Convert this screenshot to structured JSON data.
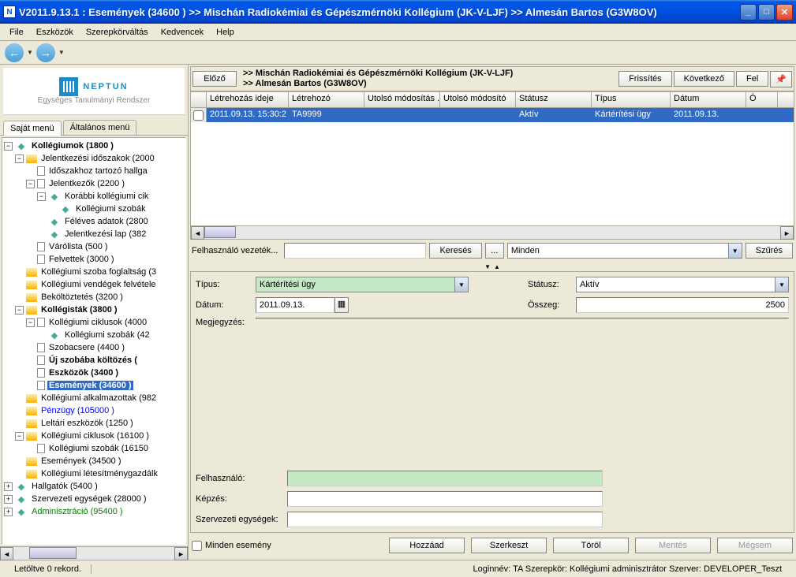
{
  "window": {
    "title": "V2011.9.13.1 : Események (34600  )   >> Mischán Radiokémiai és Gépészmérnöki Kollégium (JK-V-LJF) >> Almesán Bartos (G3W8OV)"
  },
  "menubar": [
    "File",
    "Eszközök",
    "Szerepkörváltás",
    "Kedvencek",
    "Help"
  ],
  "logo": {
    "main": "NEPTUN",
    "sub": "Egységes Tanulmányi Rendszer"
  },
  "tabs": {
    "own": "Saját menü",
    "general": "Általános menü"
  },
  "tree": [
    {
      "d": 0,
      "exp": "-",
      "icon": "diamond",
      "label": "Kollégiumok (1800  )",
      "bold": true
    },
    {
      "d": 1,
      "exp": "-",
      "icon": "folder",
      "label": "Jelentkezési időszakok (2000"
    },
    {
      "d": 2,
      "exp": "",
      "icon": "page",
      "label": "Időszakhoz tartozó hallga"
    },
    {
      "d": 2,
      "exp": "-",
      "icon": "page",
      "label": "Jelentkezők (2200  )"
    },
    {
      "d": 3,
      "exp": "-",
      "icon": "diamond",
      "label": "Korábbi kollégiumi cik"
    },
    {
      "d": 4,
      "exp": "",
      "icon": "diamond",
      "label": "Kollégiumi szobák"
    },
    {
      "d": 3,
      "exp": "",
      "icon": "diamond",
      "label": "Féléves adatok (2800"
    },
    {
      "d": 3,
      "exp": "",
      "icon": "diamond",
      "label": "Jelentkezési lap (382"
    },
    {
      "d": 2,
      "exp": "",
      "icon": "page",
      "label": "Várólista (500  )"
    },
    {
      "d": 2,
      "exp": "",
      "icon": "page",
      "label": "Felvettek (3000  )"
    },
    {
      "d": 1,
      "exp": "",
      "icon": "folder",
      "label": "Kollégiumi szoba foglaltság (3"
    },
    {
      "d": 1,
      "exp": "",
      "icon": "folder",
      "label": "Kollégiumi vendégek felvétele"
    },
    {
      "d": 1,
      "exp": "",
      "icon": "folder",
      "label": "Beköltöztetés (3200  )"
    },
    {
      "d": 1,
      "exp": "-",
      "icon": "folder",
      "label": "Kollégisták (3800  )",
      "bold": true
    },
    {
      "d": 2,
      "exp": "-",
      "icon": "page",
      "label": "Kollégiumi ciklusok (4000"
    },
    {
      "d": 3,
      "exp": "",
      "icon": "diamond",
      "label": "Kollégiumi szobák (42"
    },
    {
      "d": 2,
      "exp": "",
      "icon": "page",
      "label": "Szobacsere (4400  )"
    },
    {
      "d": 2,
      "exp": "",
      "icon": "page",
      "label": "Új szobába költözés (",
      "bold": true
    },
    {
      "d": 2,
      "exp": "",
      "icon": "page",
      "label": "Eszközök (3400  )",
      "bold": true
    },
    {
      "d": 2,
      "exp": "",
      "icon": "page",
      "label": "Események (34600  )",
      "bold": true,
      "sel": true
    },
    {
      "d": 1,
      "exp": "",
      "icon": "folder",
      "label": "Kollégiumi alkalmazottak (982"
    },
    {
      "d": 1,
      "exp": "",
      "icon": "folder",
      "label": "Pénzügy (105000  )",
      "blue": true
    },
    {
      "d": 1,
      "exp": "",
      "icon": "folder",
      "label": "Leltári eszközök (1250  )"
    },
    {
      "d": 1,
      "exp": "-",
      "icon": "folder",
      "label": "Kollégiumi ciklusok (16100  )"
    },
    {
      "d": 2,
      "exp": "",
      "icon": "page",
      "label": "Kollégiumi szobák (16150"
    },
    {
      "d": 1,
      "exp": "",
      "icon": "folder",
      "label": "Események (34500  )"
    },
    {
      "d": 1,
      "exp": "",
      "icon": "folder",
      "label": "Kollégiumi létesítménygazdálk"
    },
    {
      "d": 0,
      "exp": "+",
      "icon": "diamond",
      "label": "Hallgatók (5400  )"
    },
    {
      "d": 0,
      "exp": "+",
      "icon": "diamond",
      "label": "Szervezeti egységek (28000  )"
    },
    {
      "d": 0,
      "exp": "+",
      "icon": "diamond",
      "label": "Adminisztráció (95400  )",
      "green": true
    }
  ],
  "toolbar": {
    "prev": "Előző",
    "bc1": ">> Mischán Radiokémiai és Gépészmérnöki Kollégium (JK-V-LJF)",
    "bc2": ">> Almesán Bartos (G3W8OV)",
    "refresh": "Frissítés",
    "next": "Következő",
    "up": "Fel"
  },
  "grid": {
    "headers": [
      "",
      "Létrehozás ideje",
      "Létrehozó",
      "Utolsó módosítás ...",
      "Utolsó módosító",
      "Státusz",
      "Típus",
      "Dátum",
      "Ö"
    ],
    "row": [
      "",
      "2011.09.13. 15:30:2",
      "TA9999",
      "",
      "",
      "Aktív",
      "Kártérítési ügy",
      "2011.09.13.",
      ""
    ]
  },
  "filter": {
    "label": "Felhasználó vezeték...",
    "search": "Keresés",
    "dots": "...",
    "combo": "Minden",
    "szures": "Szűrés"
  },
  "detail": {
    "tipus_l": "Típus:",
    "tipus_v": "Kártérítési ügy",
    "statusz_l": "Státusz:",
    "statusz_v": "Aktív",
    "datum_l": "Dátum:",
    "datum_v": "2011.09.13.",
    "osszeg_l": "Összeg:",
    "osszeg_v": "2500",
    "megj_l": "Megjegyzés:",
    "felh_l": "Felhasználó:",
    "kepzes_l": "Képzés:",
    "szerv_l": "Szervezeti egységek:"
  },
  "bottom": {
    "chk": "Minden esemény",
    "add": "Hozzáad",
    "edit": "Szerkeszt",
    "del": "Töröl",
    "save": "Mentés",
    "cancel": "Mégsem"
  },
  "status": {
    "left": "Letöltve 0 rekord.",
    "right": "Loginnév: TA   Szerepkör: Kollégiumi adminisztrátor   Szerver: DEVELOPER_Teszt"
  }
}
